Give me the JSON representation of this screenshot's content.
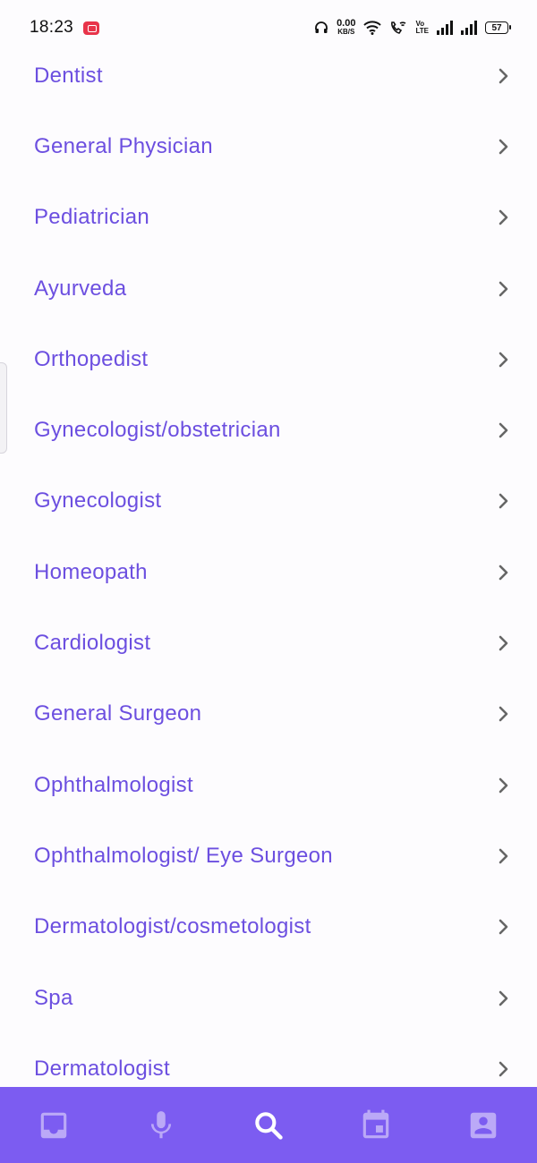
{
  "status_bar": {
    "time": "18:23",
    "net_speed_value": "0.00",
    "net_speed_unit": "KB/S",
    "volte_top": "Vo",
    "volte_bottom": "LTE",
    "battery": "57"
  },
  "specialties": [
    {
      "label": "Dentist"
    },
    {
      "label": "General Physician"
    },
    {
      "label": "Pediatrician"
    },
    {
      "label": "Ayurveda"
    },
    {
      "label": "Orthopedist"
    },
    {
      "label": "Gynecologist/obstetrician"
    },
    {
      "label": "Gynecologist"
    },
    {
      "label": "Homeopath"
    },
    {
      "label": "Cardiologist"
    },
    {
      "label": "General Surgeon"
    },
    {
      "label": "Ophthalmologist"
    },
    {
      "label": "Ophthalmologist/ Eye Surgeon"
    },
    {
      "label": "Dermatologist/cosmetologist"
    },
    {
      "label": "Spa"
    },
    {
      "label": "Dermatologist"
    }
  ],
  "bottom_nav": {
    "items": [
      {
        "icon": "inbox-icon",
        "active": false
      },
      {
        "icon": "microphone-icon",
        "active": false
      },
      {
        "icon": "search-icon",
        "active": true
      },
      {
        "icon": "calendar-icon",
        "active": false
      },
      {
        "icon": "profile-icon",
        "active": false
      }
    ]
  },
  "colors": {
    "accent": "#7c5cf1",
    "label": "#6c4fe0",
    "chevron": "#666666",
    "nav_icon_inactive": "#bba9f7",
    "nav_icon_active": "#ffffff",
    "background": "#fdfcfe"
  }
}
